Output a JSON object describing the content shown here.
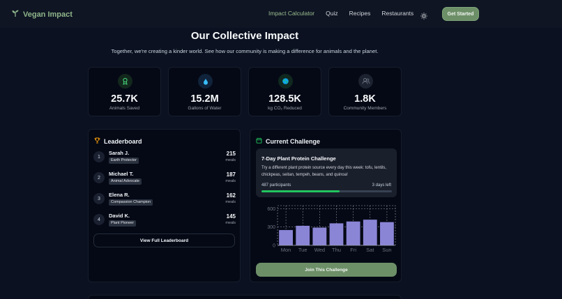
{
  "nav": {
    "brand": "Vegan Impact",
    "links": [
      {
        "label": "Impact Calculator",
        "active": true
      },
      {
        "label": "Quiz",
        "active": false
      },
      {
        "label": "Recipes",
        "active": false
      },
      {
        "label": "Restaurants",
        "active": false
      }
    ],
    "cta": "Get Started"
  },
  "hero": {
    "title": "Our Collective Impact",
    "subtitle": "Together, we're creating a kinder world. See how our community is making a difference for animals and the planet."
  },
  "stats": [
    {
      "icon": "ribbon-icon",
      "value": "25.7K",
      "label": "Animals Saved",
      "color": "#4ade80"
    },
    {
      "icon": "water-drop-icon",
      "value": "15.2M",
      "label": "Gallons of Water",
      "color": "#38bdf8"
    },
    {
      "icon": "globe-icon",
      "value": "128.5K",
      "label": "kg CO₂ Reduced",
      "color": "#22c55e"
    },
    {
      "icon": "users-icon",
      "value": "1.8K",
      "label": "Community Members",
      "color": "#6b7280"
    }
  ],
  "leaderboard": {
    "title": "Leaderboard",
    "entries": [
      {
        "rank": "1",
        "name": "Sarah J.",
        "badge": "Earth Protector",
        "score": "215",
        "unit": "meals"
      },
      {
        "rank": "2",
        "name": "Michael T.",
        "badge": "Animal Advocate",
        "score": "187",
        "unit": "meals"
      },
      {
        "rank": "3",
        "name": "Elena R.",
        "badge": "Compassion Champion",
        "score": "162",
        "unit": "meals"
      },
      {
        "rank": "4",
        "name": "David K.",
        "badge": "Plant Pioneer",
        "score": "145",
        "unit": "meals"
      }
    ],
    "button": "View Full Leaderboard"
  },
  "challenge": {
    "section_title": "Current Challenge",
    "title": "7-Day Plant Protein Challenge",
    "description": "Try a different plant protein source every day this week: tofu, lentils, chickpeas, seitan, tempeh, beans, and quinoa!",
    "participants": "487 participants",
    "days_left": "3 days left",
    "progress": 0.6,
    "button": "Join This Challenge"
  },
  "colors": {
    "accent": "#6d8f68",
    "bar": "#8b85d6",
    "progress": "#22c55e",
    "background": "#0b1120",
    "card": "#050915"
  },
  "chart_data": {
    "type": "bar",
    "categories": [
      "Mon",
      "Tue",
      "Wed",
      "Thu",
      "Fri",
      "Sat",
      "Sun"
    ],
    "values": [
      250,
      320,
      290,
      360,
      390,
      420,
      380
    ],
    "yticks": [
      0,
      300,
      600
    ],
    "ylim": [
      0,
      650
    ],
    "grid": true
  }
}
